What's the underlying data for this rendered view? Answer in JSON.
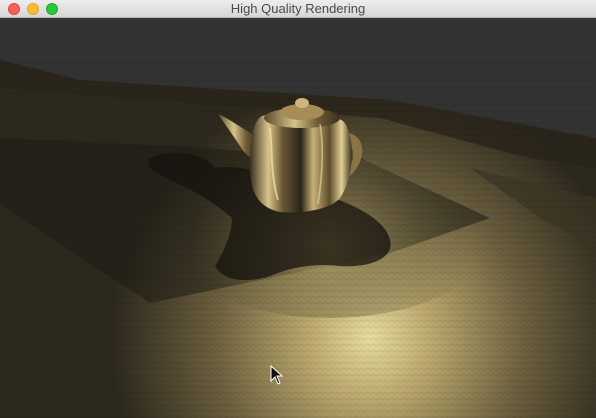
{
  "window": {
    "title": "High Quality Rendering"
  },
  "colors": {
    "background": "#333333",
    "floor_light": "#d8c98a",
    "floor_dark": "#2e2a1e",
    "teapot_gold": "#b89a5a"
  },
  "scene": {
    "objects": [
      "teapot",
      "textured-floor",
      "teapot-shadow",
      "spotlight-highlight"
    ],
    "cursor": "arrow-cursor"
  }
}
